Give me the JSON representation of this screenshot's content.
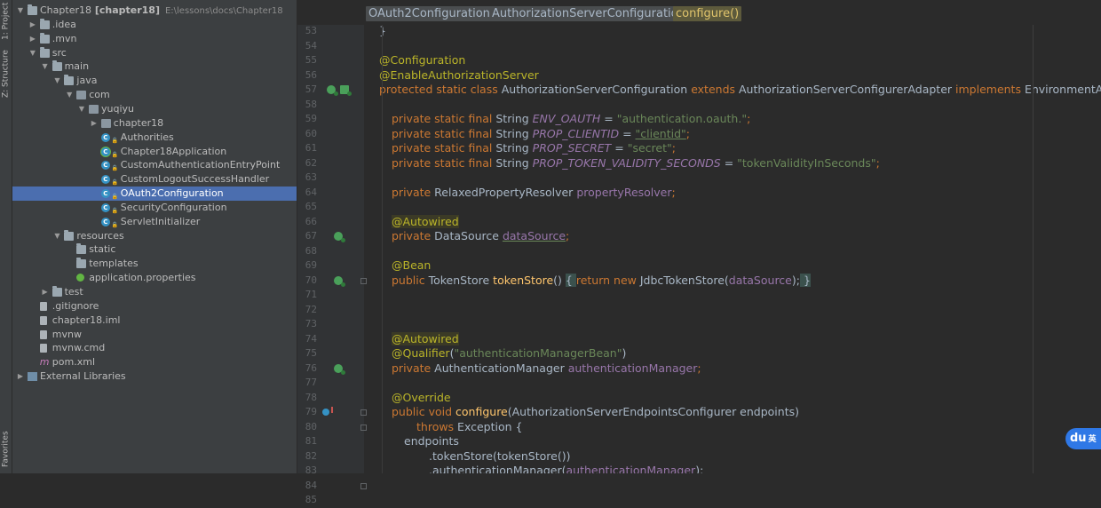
{
  "tool_tabs": {
    "project": "1: Project",
    "structure": "Z: Structure",
    "favorites": "Favorites"
  },
  "tree": [
    {
      "depth": 0,
      "expanded": true,
      "icon": "module",
      "label": "Chapter18",
      "bold": "[chapter18]",
      "path": "E:\\lessons\\docs\\Chapter18"
    },
    {
      "depth": 1,
      "expanded": false,
      "icon": "folder",
      "label": ".idea"
    },
    {
      "depth": 1,
      "expanded": false,
      "icon": "folder",
      "label": ".mvn"
    },
    {
      "depth": 1,
      "expanded": true,
      "icon": "folder",
      "label": "src"
    },
    {
      "depth": 2,
      "expanded": true,
      "icon": "folder",
      "label": "main"
    },
    {
      "depth": 3,
      "expanded": true,
      "icon": "folder",
      "label": "java"
    },
    {
      "depth": 4,
      "expanded": true,
      "icon": "package",
      "label": "com"
    },
    {
      "depth": 5,
      "expanded": true,
      "icon": "package",
      "label": "yuqiyu"
    },
    {
      "depth": 6,
      "expanded": false,
      "icon": "package",
      "label": "chapter18"
    },
    {
      "depth": 6,
      "icon": "class",
      "label": "Authorities"
    },
    {
      "depth": 6,
      "icon": "class-run",
      "label": "Chapter18Application"
    },
    {
      "depth": 6,
      "icon": "class",
      "label": "CustomAuthenticationEntryPoint"
    },
    {
      "depth": 6,
      "icon": "class",
      "label": "CustomLogoutSuccessHandler"
    },
    {
      "depth": 6,
      "icon": "class",
      "label": "OAuth2Configuration",
      "selected": true
    },
    {
      "depth": 6,
      "icon": "class",
      "label": "SecurityConfiguration"
    },
    {
      "depth": 6,
      "icon": "class",
      "label": "ServletInitializer"
    },
    {
      "depth": 3,
      "expanded": true,
      "icon": "folder",
      "label": "resources"
    },
    {
      "depth": 4,
      "icon": "folder",
      "label": "static"
    },
    {
      "depth": 4,
      "icon": "folder",
      "label": "templates"
    },
    {
      "depth": 4,
      "icon": "properties",
      "label": "application.properties"
    },
    {
      "depth": 2,
      "expanded": false,
      "icon": "folder",
      "label": "test"
    },
    {
      "depth": 1,
      "icon": "file",
      "label": ".gitignore"
    },
    {
      "depth": 1,
      "icon": "file",
      "label": "chapter18.iml"
    },
    {
      "depth": 1,
      "icon": "file",
      "label": "mvnw"
    },
    {
      "depth": 1,
      "icon": "file",
      "label": "mvnw.cmd"
    },
    {
      "depth": 1,
      "icon": "maven",
      "label": "pom.xml"
    },
    {
      "depth": 0,
      "expanded": false,
      "icon": "library",
      "label": "External Libraries"
    }
  ],
  "breadcrumbs": [
    "OAuth2Configuration",
    "AuthorizationServerConfiguration",
    "configure()"
  ],
  "code": {
    "first_line": 53,
    "lines": [
      {
        "n": 53,
        "indent": 0,
        "tokens": [
          [
            "}",
            ""
          ]
        ]
      },
      {
        "n": 54,
        "indent": 0,
        "tokens": []
      },
      {
        "n": 55,
        "indent": 0,
        "tokens": [
          [
            "@Configuration",
            "a"
          ]
        ]
      },
      {
        "n": 56,
        "indent": 0,
        "tokens": [
          [
            "@EnableAuthorizationServer",
            "a"
          ]
        ]
      },
      {
        "n": 57,
        "indent": 0,
        "gutter": "bean2",
        "tokens": [
          [
            "protected static class ",
            "k"
          ],
          [
            "AuthorizationServerConfiguration ",
            ""
          ],
          [
            "extends ",
            "k"
          ],
          [
            "AuthorizationServerConfigurerAdapter ",
            ""
          ],
          [
            "implements ",
            "k"
          ],
          [
            "EnvironmentAware {",
            ""
          ]
        ]
      },
      {
        "n": 58,
        "indent": 0,
        "tokens": []
      },
      {
        "n": 59,
        "indent": 1,
        "tokens": [
          [
            "private static final ",
            "k"
          ],
          [
            "String ",
            ""
          ],
          [
            "ENV_OAUTH",
            "f"
          ],
          [
            " = ",
            ""
          ],
          [
            "\"authentication.oauth.\"",
            "s"
          ],
          [
            ";",
            "k"
          ]
        ]
      },
      {
        "n": 60,
        "indent": 1,
        "tokens": [
          [
            "private static final ",
            "k"
          ],
          [
            "String ",
            ""
          ],
          [
            "PROP_CLIENTID",
            "f"
          ],
          [
            " = ",
            ""
          ],
          [
            "\"clientid\"",
            "s-ul"
          ],
          [
            ";",
            "k"
          ]
        ]
      },
      {
        "n": 61,
        "indent": 1,
        "tokens": [
          [
            "private static final ",
            "k"
          ],
          [
            "String ",
            ""
          ],
          [
            "PROP_SECRET",
            "f"
          ],
          [
            " = ",
            ""
          ],
          [
            "\"secret\"",
            "s"
          ],
          [
            ";",
            "k"
          ]
        ]
      },
      {
        "n": 62,
        "indent": 1,
        "tokens": [
          [
            "private static final ",
            "k"
          ],
          [
            "String ",
            ""
          ],
          [
            "PROP_TOKEN_VALIDITY_SECONDS",
            "f"
          ],
          [
            " = ",
            ""
          ],
          [
            "\"tokenValidityInSeconds\"",
            "s"
          ],
          [
            ";",
            "k"
          ]
        ]
      },
      {
        "n": 63,
        "indent": 1,
        "tokens": []
      },
      {
        "n": 64,
        "indent": 1,
        "tokens": [
          [
            "private ",
            "k"
          ],
          [
            "RelaxedPropertyResolver ",
            ""
          ],
          [
            "propertyResolver",
            "fi"
          ],
          [
            ";",
            "k"
          ]
        ]
      },
      {
        "n": 65,
        "indent": 1,
        "tokens": []
      },
      {
        "n": 66,
        "indent": 1,
        "tokens": [
          [
            "@Autowired",
            "a-h"
          ]
        ]
      },
      {
        "n": 67,
        "indent": 1,
        "gutter": "bean",
        "tokens": [
          [
            "private ",
            "k"
          ],
          [
            "DataSource ",
            ""
          ],
          [
            "dataSource",
            "fi-ul"
          ],
          [
            ";",
            "k"
          ]
        ]
      },
      {
        "n": 68,
        "indent": 1,
        "tokens": []
      },
      {
        "n": 69,
        "indent": 1,
        "tokens": [
          [
            "@Bean",
            "a"
          ]
        ]
      },
      {
        "n": 70,
        "indent": 1,
        "gutter": "bean",
        "fold": true,
        "tokens": [
          [
            "public ",
            "k"
          ],
          [
            "TokenStore ",
            ""
          ],
          [
            "tokenStore",
            "m"
          ],
          [
            "() ",
            ""
          ],
          [
            "{ ",
            "br"
          ],
          [
            "return new ",
            "k"
          ],
          [
            "JdbcTokenStore(",
            ""
          ],
          [
            "dataSource",
            "fi"
          ],
          [
            ");",
            ""
          ],
          [
            " }",
            "br"
          ]
        ]
      },
      {
        "n": 71,
        "indent": 1,
        "tokens": []
      },
      {
        "n": 72,
        "indent": 1,
        "tokens": []
      },
      {
        "n": 73,
        "indent": 1,
        "tokens": []
      },
      {
        "n": 74,
        "indent": 1,
        "tokens": [
          [
            "@Autowired",
            "a-h"
          ]
        ]
      },
      {
        "n": 75,
        "indent": 1,
        "tokens": [
          [
            "@Qualifier",
            "a"
          ],
          [
            "(",
            ""
          ],
          [
            "\"authenticationManagerBean\"",
            "s"
          ],
          [
            ")",
            ""
          ]
        ]
      },
      {
        "n": 76,
        "indent": 1,
        "gutter": "bean",
        "tokens": [
          [
            "private ",
            "k"
          ],
          [
            "AuthenticationManager ",
            ""
          ],
          [
            "authenticationManager",
            "fi"
          ],
          [
            ";",
            "k"
          ]
        ]
      },
      {
        "n": 77,
        "indent": 1,
        "tokens": []
      },
      {
        "n": 78,
        "indent": 1,
        "tokens": [
          [
            "@Override",
            "a"
          ]
        ]
      },
      {
        "n": 79,
        "indent": 1,
        "gutter": "override",
        "fold": true,
        "tokens": [
          [
            "public void ",
            "k"
          ],
          [
            "configure",
            "m"
          ],
          [
            "(AuthorizationServerEndpointsConfigurer endpoints)",
            ""
          ]
        ]
      },
      {
        "n": 80,
        "indent": 3,
        "fold": true,
        "tokens": [
          [
            "throws ",
            "k"
          ],
          [
            "Exception {",
            ""
          ]
        ]
      },
      {
        "n": 81,
        "indent": 2,
        "tokens": [
          [
            "endpoints",
            ""
          ]
        ]
      },
      {
        "n": 82,
        "indent": 4,
        "tokens": [
          [
            ".tokenStore(tokenStore())",
            ""
          ]
        ]
      },
      {
        "n": 83,
        "indent": 4,
        "tokens": [
          [
            ".authenticationManager(",
            ""
          ],
          [
            "authenticationManager",
            "fi"
          ],
          [
            ");",
            ""
          ]
        ]
      },
      {
        "n": 84,
        "indent": 1,
        "fold": true,
        "tokens": [
          [
            "}",
            ""
          ]
        ]
      },
      {
        "n": 85,
        "indent": 1,
        "tokens": []
      }
    ]
  },
  "baidu_badge": {
    "logo": "du",
    "text": "英"
  }
}
